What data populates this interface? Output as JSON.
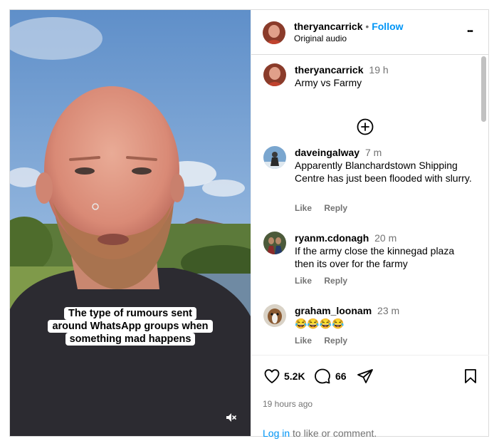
{
  "post": {
    "author": "theryancarrick",
    "separator": "•",
    "follow_label": "Follow",
    "audio_label": "Original audio",
    "more_label": "•••"
  },
  "media": {
    "caption_lines": [
      "The type of rumours sent",
      "around WhatsApp groups when",
      "something mad happens"
    ],
    "mute_icon": "speaker-muted-icon"
  },
  "caption_comment": {
    "username": "theryancarrick",
    "time": "19 h",
    "text": "Army vs Farmy"
  },
  "load_more_icon": "plus-circle-icon",
  "comments": [
    {
      "username": "daveingalway",
      "time": "7 m",
      "text": "Apparently Blanchardstown Shipping Centre has just been flooded with slurry.",
      "like_label": "Like",
      "reply_label": "Reply"
    },
    {
      "username": "ryanm.cdonagh",
      "time": "20 m",
      "text": "If the army close the kinnegad plaza then its over for the farmy",
      "like_label": "Like",
      "reply_label": "Reply"
    },
    {
      "username": "graham_loonam",
      "time": "23 m",
      "text": "😂😂😂😂",
      "like_label": "Like",
      "reply_label": "Reply"
    }
  ],
  "stats": {
    "likes": "5.2K",
    "comments": "66",
    "posted_ago": "19 hours ago"
  },
  "login_prompt": {
    "link": "Log in",
    "rest": "to like or comment."
  },
  "colors": {
    "link_blue": "#0095f6",
    "muted_text": "#737373",
    "border": "#dbdbdb"
  }
}
